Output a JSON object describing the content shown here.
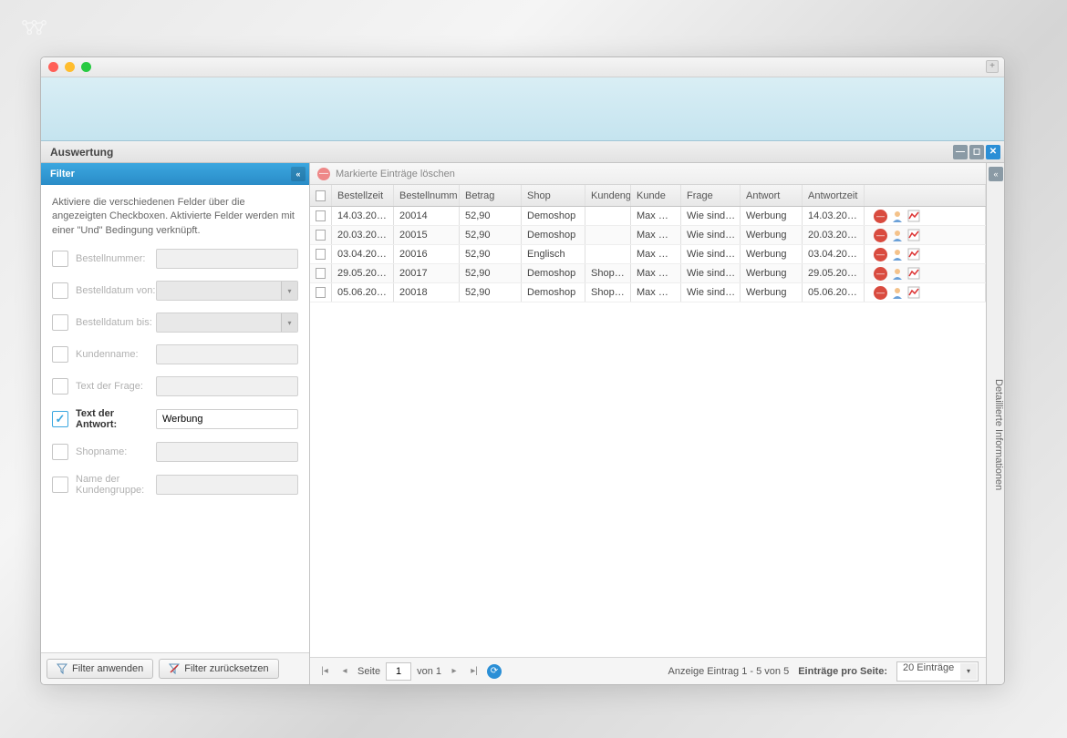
{
  "panel": {
    "title": "Auswertung"
  },
  "filter": {
    "title": "Filter",
    "description": "Aktiviere die verschiedenen Felder über die angezeigten Checkboxen. Aktivierte Felder werden mit einer \"Und\" Bedingung verknüpft.",
    "fields": {
      "bestellnummer": {
        "label": "Bestellnummer:",
        "value": "",
        "checked": false
      },
      "bestelldatum_von": {
        "label": "Bestelldatum von:",
        "value": "",
        "checked": false
      },
      "bestelldatum_bis": {
        "label": "Bestelldatum bis:",
        "value": "",
        "checked": false
      },
      "kundenname": {
        "label": "Kundenname:",
        "value": "",
        "checked": false
      },
      "text_frage": {
        "label": "Text der Frage:",
        "value": "",
        "checked": false
      },
      "text_antwort": {
        "label": "Text der Antwort:",
        "value": "Werbung",
        "checked": true
      },
      "shopname": {
        "label": "Shopname:",
        "value": "",
        "checked": false
      },
      "kundengruppe": {
        "label": "Name der Kundengruppe:",
        "value": "",
        "checked": false
      }
    },
    "apply": "Filter anwenden",
    "reset": "Filter zurücksetzen"
  },
  "grid": {
    "delete_marked": "Markierte Einträge löschen",
    "columns": [
      "Bestellzeit",
      "Bestellnumm",
      "Betrag",
      "Shop",
      "Kundeng",
      "Kunde",
      "Frage",
      "Antwort",
      "Antwortzeit"
    ],
    "rows": [
      {
        "c": [
          "14.03.20…",
          "20014",
          "52,90",
          "Demoshop",
          "",
          "Max …",
          "Wie sind…",
          "Werbung",
          "14.03.20…"
        ]
      },
      {
        "c": [
          "20.03.20…",
          "20015",
          "52,90",
          "Demoshop",
          "",
          "Max …",
          "Wie sind…",
          "Werbung",
          "20.03.20…"
        ]
      },
      {
        "c": [
          "03.04.20…",
          "20016",
          "52,90",
          "Englisch",
          "",
          "Max …",
          "Wie sind…",
          "Werbung",
          "03.04.20…"
        ]
      },
      {
        "c": [
          "29.05.20…",
          "20017",
          "52,90",
          "Demoshop",
          "Shop…",
          "Max …",
          "Wie sind…",
          "Werbung",
          "29.05.20…"
        ]
      },
      {
        "c": [
          "05.06.20…",
          "20018",
          "52,90",
          "Demoshop",
          "Shop…",
          "Max …",
          "Wie sind…",
          "Werbung",
          "05.06.20…"
        ]
      }
    ]
  },
  "pager": {
    "page_label": "Seite",
    "page": "1",
    "of": "von 1",
    "display": "Anzeige Eintrag 1 - 5 von 5",
    "per_page_label": "Einträge pro Seite:",
    "per_page": "20 Einträge"
  },
  "detail": {
    "title": "Detaillierte Informationen"
  }
}
